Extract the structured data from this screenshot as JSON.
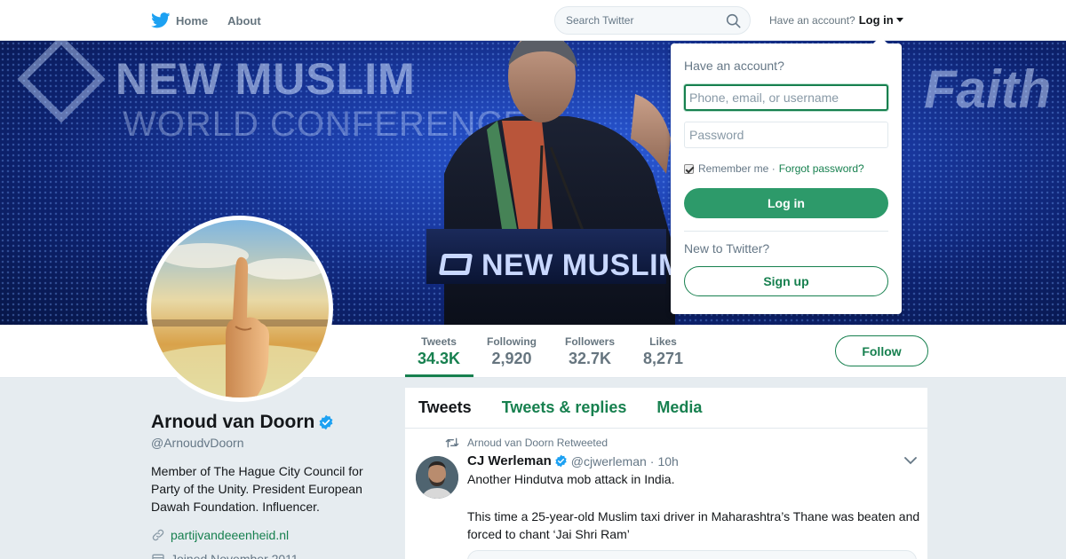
{
  "nav": {
    "home_label": "Home",
    "about_label": "About",
    "search_placeholder": "Search Twitter",
    "account_prompt": "Have an account?",
    "login_label": "Log in"
  },
  "banner": {
    "watermark_line1": "NEW MUSLIM",
    "watermark_line2": "WORLD CONFERENCE",
    "watermark_right": "Faith",
    "podium_text": "NEW MUSLIM"
  },
  "profile": {
    "name": "Arnoud van Doorn",
    "verified": true,
    "handle": "@ArnoudvDoorn",
    "bio": "Member of The Hague City Council for Party of the Unity. President European Dawah Foundation. Influencer.",
    "website": "partijvandeeenheid.nl",
    "joined": "Joined November 2011"
  },
  "stats": [
    {
      "label": "Tweets",
      "value": "34.3K",
      "active": true
    },
    {
      "label": "Following",
      "value": "2,920",
      "active": false
    },
    {
      "label": "Followers",
      "value": "32.7K",
      "active": false
    },
    {
      "label": "Likes",
      "value": "8,271",
      "active": false
    }
  ],
  "follow_label": "Follow",
  "timeline": {
    "tabs": [
      {
        "label": "Tweets",
        "active": true
      },
      {
        "label": "Tweets & replies",
        "active": false
      },
      {
        "label": "Media",
        "active": false
      }
    ],
    "tweet": {
      "context": "Arnoud van Doorn Retweeted",
      "author_name": "CJ Werleman",
      "author_handle": "@cjwerleman",
      "separator": "·",
      "time": "10h",
      "text_line1": "Another Hindutva mob attack in India.",
      "text_line2": "This time a 25-year-old Muslim taxi driver in Maharashtra’s Thane was beaten and forced to chant ‘Jai Shri Ram’"
    }
  },
  "login_dropdown": {
    "title": "Have an account?",
    "username_placeholder": "Phone, email, or username",
    "password_placeholder": "Password",
    "remember_label": "Remember me ·",
    "forgot_label": "Forgot password?",
    "login_button": "Log in",
    "new_prompt": "New to Twitter?",
    "signup_button": "Sign up",
    "remember_checked": true
  },
  "colors": {
    "accent": "#17804f",
    "accent_button": "#2d9a6a",
    "twitter_blue": "#1da1f2",
    "verified_blue": "#1da1f2"
  }
}
